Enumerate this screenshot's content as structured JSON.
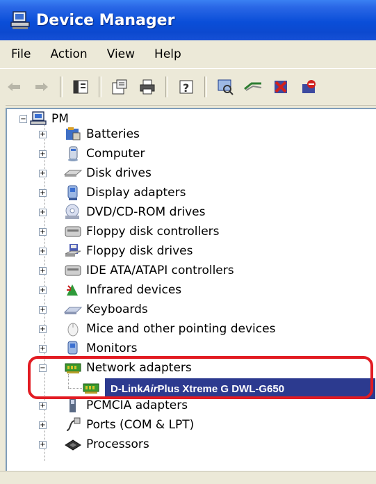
{
  "window": {
    "title": "Device Manager"
  },
  "menu": [
    "File",
    "Action",
    "View",
    "Help"
  ],
  "toolbar": {
    "buttons": [
      "back-arrow-icon",
      "forward-arrow-icon",
      "show-hide-tree-icon",
      "properties-icon",
      "print-icon",
      "help-icon",
      "scan-hardware-icon",
      "update-driver-icon",
      "uninstall-icon",
      "disable-icon"
    ]
  },
  "tree": {
    "root": "PM",
    "categories": [
      {
        "label": "Batteries",
        "icon": "battery-icon"
      },
      {
        "label": "Computer",
        "icon": "computer-icon"
      },
      {
        "label": "Disk drives",
        "icon": "disk-drive-icon"
      },
      {
        "label": "Display adapters",
        "icon": "display-adapter-icon"
      },
      {
        "label": "DVD/CD-ROM drives",
        "icon": "cdrom-icon"
      },
      {
        "label": "Floppy disk controllers",
        "icon": "controller-icon"
      },
      {
        "label": "Floppy disk drives",
        "icon": "floppy-icon"
      },
      {
        "label": "IDE ATA/ATAPI controllers",
        "icon": "ide-controller-icon"
      },
      {
        "label": "Infrared devices",
        "icon": "infrared-icon"
      },
      {
        "label": "Keyboards",
        "icon": "keyboard-icon"
      },
      {
        "label": "Mice and other pointing devices",
        "icon": "mouse-icon"
      },
      {
        "label": "Monitors",
        "icon": "monitor-icon"
      },
      {
        "label": "Network adapters",
        "icon": "network-adapter-icon"
      },
      {
        "label": "PCMCIA adapters",
        "icon": "pcmcia-icon"
      },
      {
        "label": "Ports (COM & LPT)",
        "icon": "port-icon"
      },
      {
        "label": "Processors",
        "icon": "processor-icon"
      }
    ],
    "selected_device": {
      "prefix": "D-Link ",
      "italic": "Air",
      "suffix": "Plus Xtreme G DWL-G650"
    }
  }
}
